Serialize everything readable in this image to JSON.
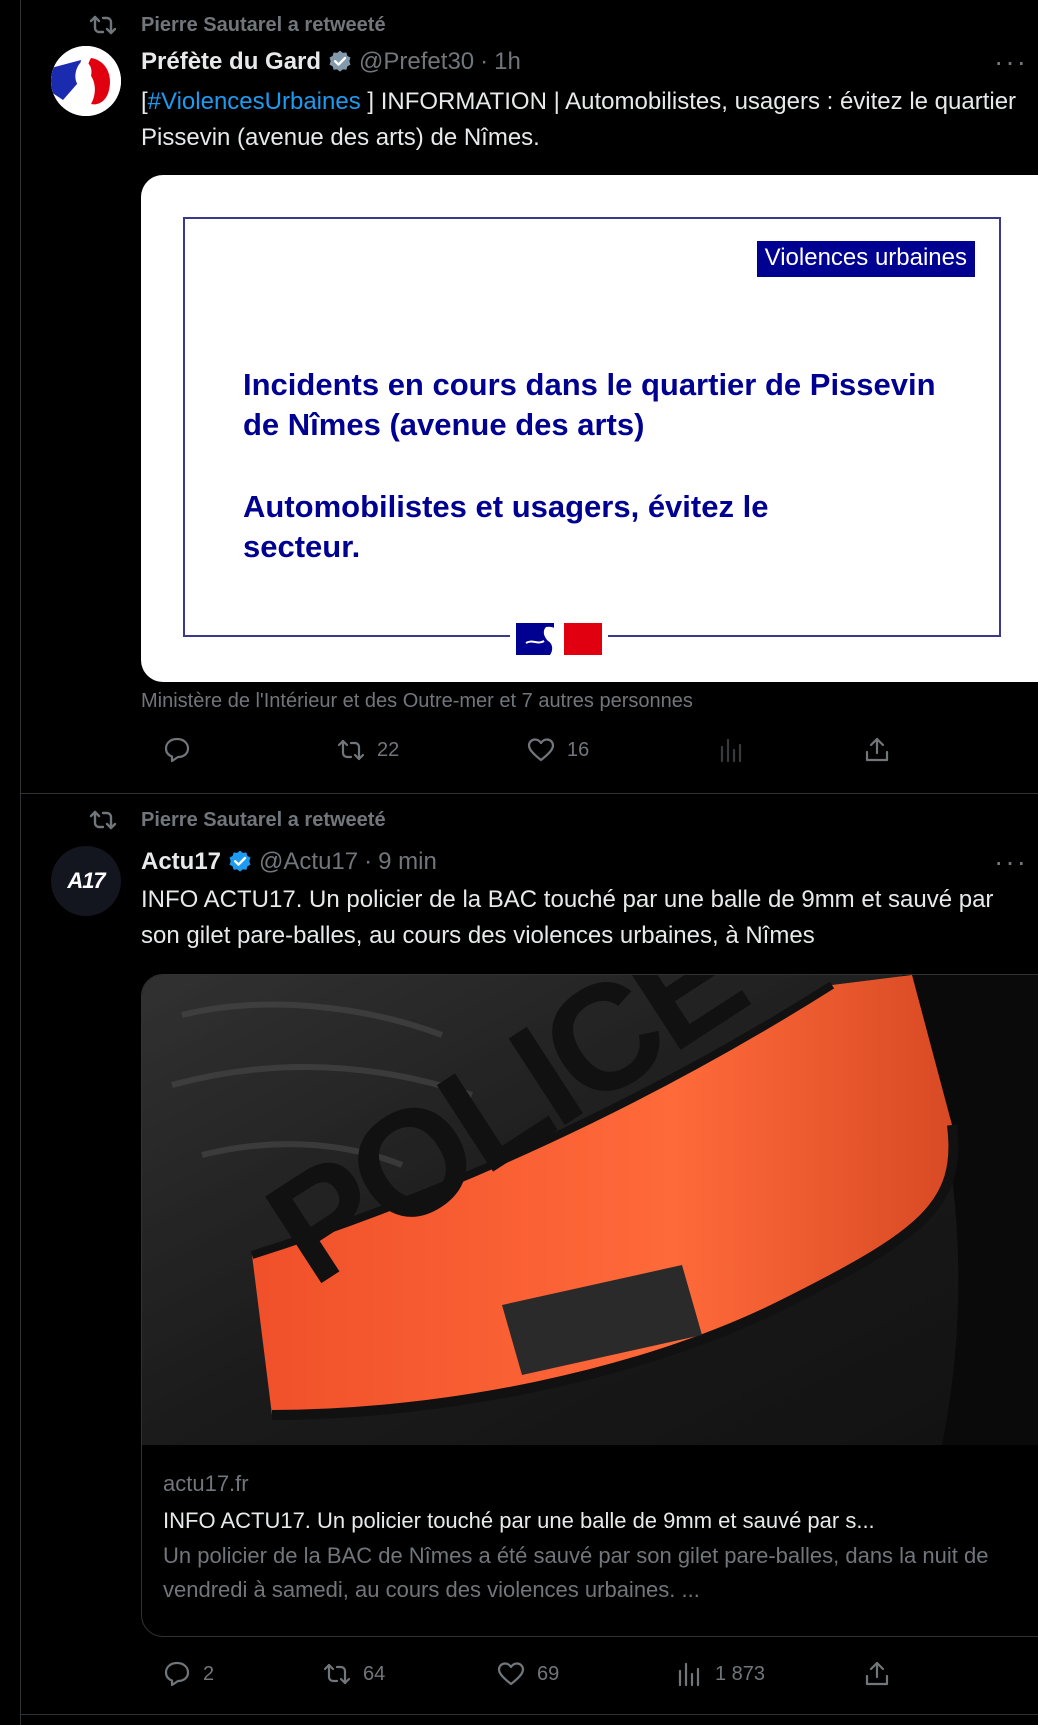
{
  "colors": {
    "background": "#000000",
    "text": "#e7e9ea",
    "muted": "#71767b",
    "link": "#1d9bf0",
    "verified": "#1d9bf0",
    "border": "#2f3336",
    "prefecture_blue": "#000091"
  },
  "tweets": [
    {
      "retweet_label": "Pierre Sautarel a retweeté",
      "author_name": "Préfète du Gard",
      "handle": "@Prefet30",
      "separator": "·",
      "time": "1h",
      "more": "···",
      "text_prefix": "[",
      "hashtag": "#ViolencesUrbaines",
      "text_rest": " ] INFORMATION | Automobilistes, usagers : évitez le quartier Pissevin (avenue des arts) de Nîmes.",
      "image": {
        "badge": "Violences urbaines",
        "line1": "Incidents en cours dans le quartier de Pissevin de Nîmes (avenue des arts)",
        "line2": "Automobilistes et usagers, évitez le secteur."
      },
      "social_context": "Ministère de l'Intérieur et des Outre-mer et 7 autres personnes",
      "actions": {
        "replies": "",
        "retweets": "22",
        "likes": "16",
        "views": ""
      }
    },
    {
      "retweet_label": "Pierre Sautarel a retweeté",
      "author_name": "Actu17",
      "avatar_text": "A17",
      "handle": "@Actu17",
      "separator": "·",
      "time": "9 min",
      "more": "···",
      "text": "INFO ACTU17. Un policier de la BAC touché par une balle de 9mm et sauvé par son gilet pare-balles, au cours des violences urbaines, à Nîmes",
      "photo_text": "POLICE",
      "card": {
        "domain": "actu17.fr",
        "title": "INFO ACTU17. Un policier touché par une balle de 9mm et sauvé par s...",
        "description": "Un policier de la BAC de Nîmes a été sauvé par son gilet pare-balles, dans la nuit de vendredi à samedi, au cours des violences urbaines. ..."
      },
      "actions": {
        "replies": "2",
        "retweets": "64",
        "likes": "69",
        "views": "1 873"
      }
    }
  ]
}
